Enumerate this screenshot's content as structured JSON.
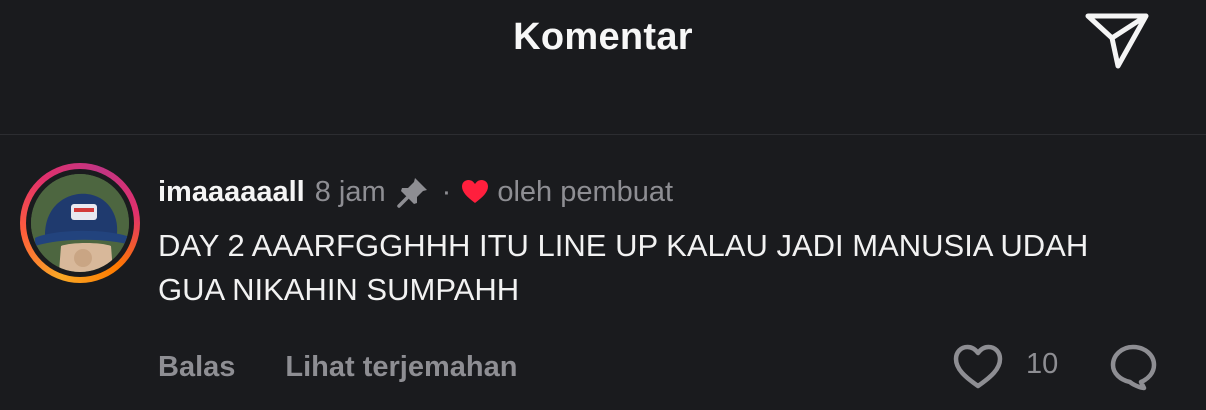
{
  "header": {
    "title": "Komentar"
  },
  "comment": {
    "username": "imaaaaaall",
    "time": "8 jam",
    "separator": "·",
    "liked_by_author_label": "oleh pembuat",
    "text": "DAY 2 AAARFGGHHH ITU LINE UP KALAU JADI MANUSIA UDAH GUA NIKAHIN SUMPAHH",
    "like_count": "10"
  },
  "actions": {
    "reply_label": "Balas",
    "translate_label": "Lihat terjemahan"
  },
  "icons": {
    "share": "send-icon",
    "pin": "pin-icon",
    "author_like": "heart-filled-icon",
    "like": "heart-outline-icon",
    "reply": "speech-bubble-icon"
  },
  "colors": {
    "background": "#1a1b1e",
    "muted_text": "#8e8e93",
    "heart_red": "#ff1f3d"
  }
}
